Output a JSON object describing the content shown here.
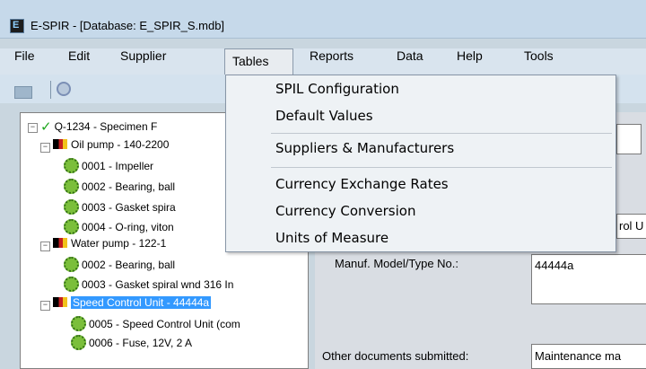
{
  "window": {
    "title": "E-SPIR - [Database: E_SPIR_S.mdb]",
    "app_icon": "E"
  },
  "menubar": {
    "items": [
      {
        "label": "File"
      },
      {
        "label": "Edit"
      },
      {
        "label": "Supplier"
      },
      {
        "label": "Tables"
      },
      {
        "label": "Reports"
      },
      {
        "label": "Data"
      },
      {
        "label": "Help"
      },
      {
        "label": "Tools"
      }
    ],
    "active": "Tables"
  },
  "tables_menu": {
    "items": [
      "SPIL Configuration",
      "Default Values",
      "Suppliers & Manufacturers",
      "Currency Exchange Rates",
      "Currency Conversion",
      "Units of Measure"
    ]
  },
  "tree": {
    "nodes": [
      {
        "label": "Q-1234 - Specimen F",
        "icon": "check-icon"
      },
      {
        "label": "Oil pump - 140-2200",
        "icon": "pump-icon"
      },
      {
        "label": "0001 - Impeller",
        "icon": "part-icon"
      },
      {
        "label": "0002 - Bearing, ball",
        "icon": "part-icon"
      },
      {
        "label": "0003 - Gasket spira",
        "icon": "part-icon"
      },
      {
        "label": "0004 - O-ring, viton",
        "icon": "part-icon"
      },
      {
        "label": "Water pump - 122-1",
        "icon": "pump-icon"
      },
      {
        "label": "0002 - Bearing, ball",
        "icon": "part-icon"
      },
      {
        "label": "0003 - Gasket spiral wnd 316 In",
        "icon": "part-icon"
      },
      {
        "label": "Speed Control Unit - 44444a",
        "icon": "pump-icon",
        "selected": true
      },
      {
        "label": "0005 - Speed Control Unit (com",
        "icon": "part-icon"
      },
      {
        "label": "0006 - Fuse, 12V, 2 A",
        "icon": "part-icon"
      }
    ]
  },
  "detail": {
    "unit_field_value": "rol U",
    "model_label": "Manuf. Model/Type No.:",
    "model_value": "44444a",
    "other_docs_label": "Other documents submitted:",
    "other_docs_value": "Maintenance ma"
  }
}
